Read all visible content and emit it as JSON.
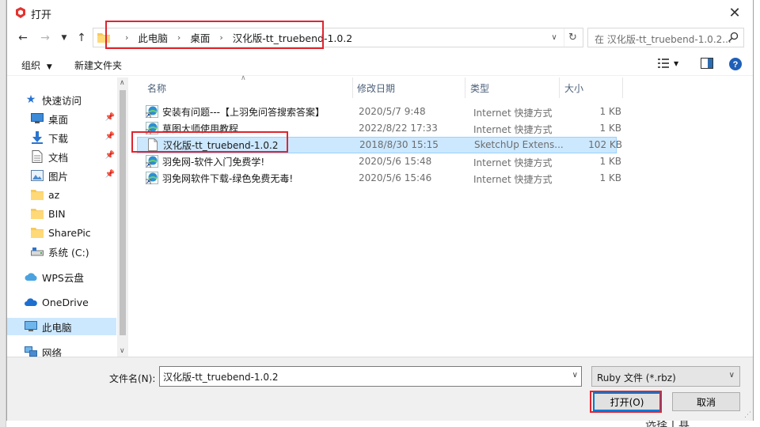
{
  "window": {
    "title": "打开"
  },
  "nav": {
    "breadcrumbs": [
      "此电脑",
      "桌面",
      "汉化版-tt_truebend-1.0.2"
    ],
    "search_placeholder": "在 汉化版-tt_truebend-1.0.2... "
  },
  "toolbar": {
    "organize": "组织",
    "new_folder": "新建文件夹"
  },
  "sidebar": {
    "items": [
      {
        "label": "快速访问",
        "icon": "star-icon"
      },
      {
        "label": "桌面",
        "icon": "desktop-icon",
        "pinned": true
      },
      {
        "label": "下载",
        "icon": "download-icon",
        "pinned": true
      },
      {
        "label": "文档",
        "icon": "document-icon",
        "pinned": true
      },
      {
        "label": "图片",
        "icon": "picture-icon",
        "pinned": true
      },
      {
        "label": "az",
        "icon": "folder-icon"
      },
      {
        "label": "BIN",
        "icon": "folder-icon"
      },
      {
        "label": "SharePic",
        "icon": "folder-icon"
      },
      {
        "label": "系统 (C:)",
        "icon": "drive-icon"
      },
      {
        "label": "WPS云盘",
        "icon": "cloud-icon"
      },
      {
        "label": "OneDrive",
        "icon": "onedrive-icon"
      },
      {
        "label": "此电脑",
        "icon": "computer-icon",
        "selected": true
      },
      {
        "label": "网络",
        "icon": "network-icon"
      }
    ]
  },
  "columns": {
    "name": "名称",
    "date": "修改日期",
    "type": "类型",
    "size": "大小"
  },
  "files": [
    {
      "name": "安装有问题---【上羽免问答搜索答案】",
      "date": "2020/5/7 9:48",
      "type": "Internet 快捷方式",
      "size": "1 KB",
      "icon": "internet-shortcut-icon"
    },
    {
      "name": "草图大师使用教程",
      "date": "2022/8/22 17:33",
      "type": "Internet 快捷方式",
      "size": "1 KB",
      "icon": "internet-shortcut-icon"
    },
    {
      "name": "汉化版-tt_truebend-1.0.2",
      "date": "2018/8/30 15:15",
      "type": "SketchUp Extens...",
      "size": "102 KB",
      "icon": "file-icon",
      "selected": true
    },
    {
      "name": "羽免网-软件入门免费学!",
      "date": "2020/5/6 15:48",
      "type": "Internet 快捷方式",
      "size": "1 KB",
      "icon": "internet-shortcut-icon"
    },
    {
      "name": "羽免网软件下载-绿色免费无毒!",
      "date": "2020/5/6 15:46",
      "type": "Internet 快捷方式",
      "size": "1 KB",
      "icon": "internet-shortcut-icon"
    }
  ],
  "bottom": {
    "filename_label": "文件名(N):",
    "filename_value": "汉化版-tt_truebend-1.0.2",
    "filetype": "Ruby 文件 (*.rbz)",
    "open_label": "打开(O)",
    "cancel_label": "取消"
  },
  "background": {
    "text": "选择工具"
  },
  "colors": {
    "selection": "#cce8ff",
    "highlight_red": "#e0252f",
    "accent": "#0078d7"
  }
}
